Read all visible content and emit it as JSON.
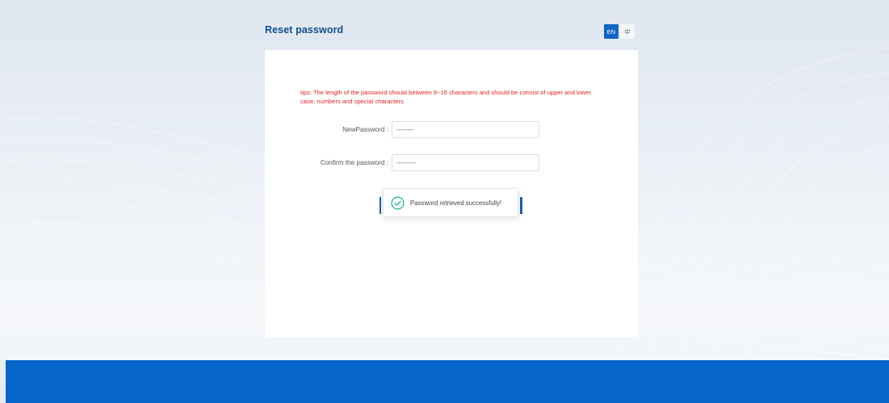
{
  "header": {
    "title": "Reset password"
  },
  "language": {
    "options": [
      "EN",
      "中"
    ],
    "selected": "EN"
  },
  "form": {
    "tips": "tips: The length of the password should between 8~16 characters and should be consist of upper and lower case, numbers and special characters",
    "new_password": {
      "label": "NewPassword :",
      "value": "--------"
    },
    "confirm_password": {
      "label": "Confirm the password :",
      "value": "---------"
    }
  },
  "toast": {
    "icon": "check-circle-icon",
    "message": "Password retrieved successfully!"
  },
  "colors": {
    "brand": "#0865c9",
    "title": "#0d4f8f",
    "tips": "#e02424",
    "success": "#19b394"
  }
}
